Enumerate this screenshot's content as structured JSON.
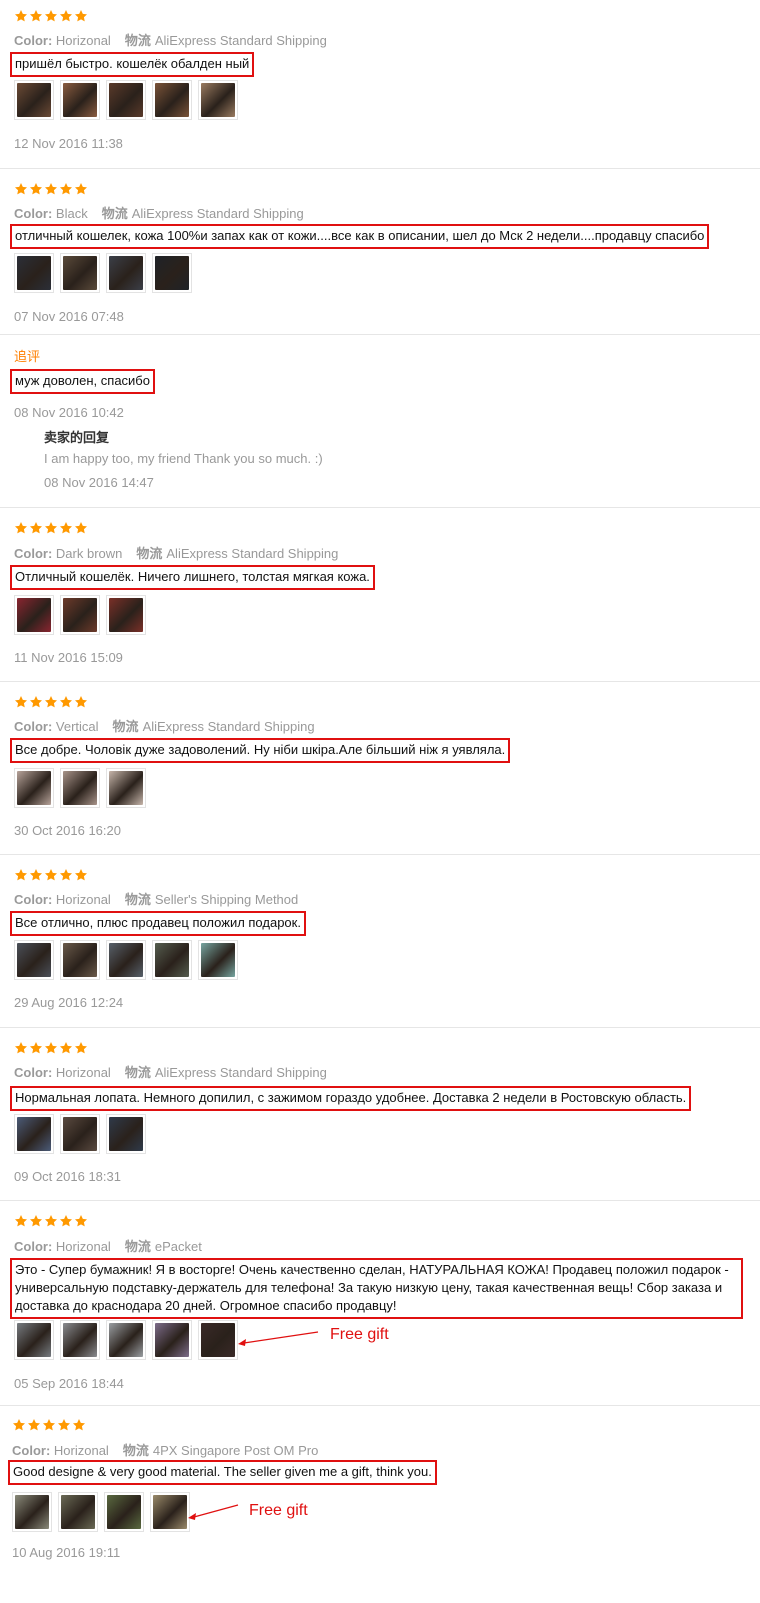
{
  "labels": {
    "color": "Color:",
    "logistics": "物流",
    "additional_review": "追评",
    "seller_reply": "卖家的回复"
  },
  "colors": {
    "star": "#ff9900",
    "highlight_border": "#e01010",
    "additional_label": "#ff7f00",
    "annotation": "#e01010"
  },
  "reviews": [
    {
      "rating": 5,
      "color": "Horizonal",
      "shipping": "AliExpress Standard Shipping",
      "comment": "пришёл быстро. кошелёк обалден ный",
      "photos": 5,
      "date": "12 Nov 2016 11:38"
    },
    {
      "rating": 5,
      "color": "Black",
      "shipping": "AliExpress Standard Shipping",
      "comment": "отличный кошелек, кожа 100%и запах как от кожи....все как в описании, шел до Мск 2 недели....продавцу спасибо",
      "photos": 4,
      "date": "07 Nov 2016 07:48",
      "additional": {
        "comment": "муж доволен, спасибо",
        "date": "08 Nov 2016 10:42",
        "reply_text": "I am happy too, my friend Thank you so much. :)",
        "reply_date": "08 Nov 2016 14:47"
      }
    },
    {
      "rating": 5,
      "color": "Dark brown",
      "shipping": "AliExpress Standard Shipping",
      "comment": "Отличный кошелёк. Ничего лишнего, толстая мягкая кожа.",
      "photos": 3,
      "date": "11 Nov 2016 15:09"
    },
    {
      "rating": 5,
      "color": "Vertical",
      "shipping": "AliExpress Standard Shipping",
      "comment": "Все добре. Чоловік дуже задоволений. Ну ніби шкіра.Але більший ніж я уявляла.",
      "photos": 3,
      "date": "30 Oct 2016 16:20"
    },
    {
      "rating": 5,
      "color": "Horizonal",
      "shipping": "Seller's Shipping Method",
      "comment": "Все отлично, плюс продавец положил подарок.",
      "photos": 5,
      "date": "29 Aug 2016 12:24"
    },
    {
      "rating": 5,
      "color": "Horizonal",
      "shipping": "AliExpress Standard Shipping",
      "comment": "Нормальная лопата. Немного допилил, с зажимом гораздо удобнее. Доставка 2 недели в Ростовскую область.",
      "photos": 3,
      "date": "09 Oct 2016 18:31"
    },
    {
      "rating": 5,
      "color": "Horizonal",
      "shipping": "ePacket",
      "comment": "Это - Супер бумажник! Я в восторге! Очень качественно сделан, НАТУРАЛЬНАЯ КОЖА! Продавец положил подарок - универсальную подставку-держатель для телефона! За такую низкую цену, такая качественная вещь! Сбор заказа и доставка до краснодара 20 дней. Огромное спасибо продавцу!",
      "photos": 5,
      "date": "05 Sep 2016 18:44",
      "annotation": "Free gift"
    },
    {
      "rating": 5,
      "color": "Horizonal",
      "shipping": "4PX Singapore Post OM Pro",
      "comment": "Good designe & very good material. The seller given me a gift, think you.",
      "photos": 4,
      "date": "10 Aug 2016 19:11",
      "annotation": "Free gift"
    }
  ]
}
